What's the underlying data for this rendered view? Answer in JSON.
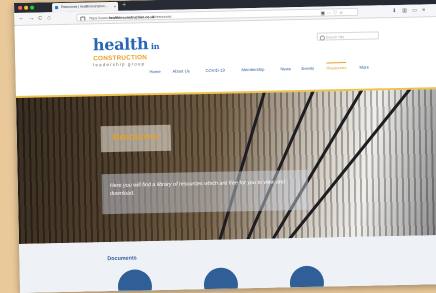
{
  "browser": {
    "tab_title": "Resources | healthinconstruc...",
    "tab_close": "×",
    "new_tab": "+",
    "url_prefix": "https://www.",
    "url_domain": "healthinconstruction.co.uk",
    "url_path": "/resources",
    "back": "←",
    "forward": "→",
    "reload": "C",
    "home": "⌂",
    "url_actions": "▣  ···  ♡  ☆"
  },
  "site": {
    "logo_main": "health",
    "logo_in": " in",
    "logo_construction": "CONSTRUCTION",
    "logo_sub": "leadership group",
    "search_placeholder": "Search Site",
    "menu": [
      {
        "label": "Home"
      },
      {
        "label": "About Us"
      },
      {
        "label": "COVID-19"
      },
      {
        "label": "Membership"
      },
      {
        "label": "News"
      },
      {
        "label": "Events"
      },
      {
        "label": "Resources"
      },
      {
        "label": "More"
      }
    ],
    "active_menu": "Resources",
    "hero_title": "Resources",
    "hero_text": "Here you will find a library of resources which are free for you to view and download.",
    "documents_heading": "Documents"
  },
  "colors": {
    "brand_blue": "#2866b6",
    "brand_orange": "#e7a127",
    "background": "#e9c99a"
  }
}
